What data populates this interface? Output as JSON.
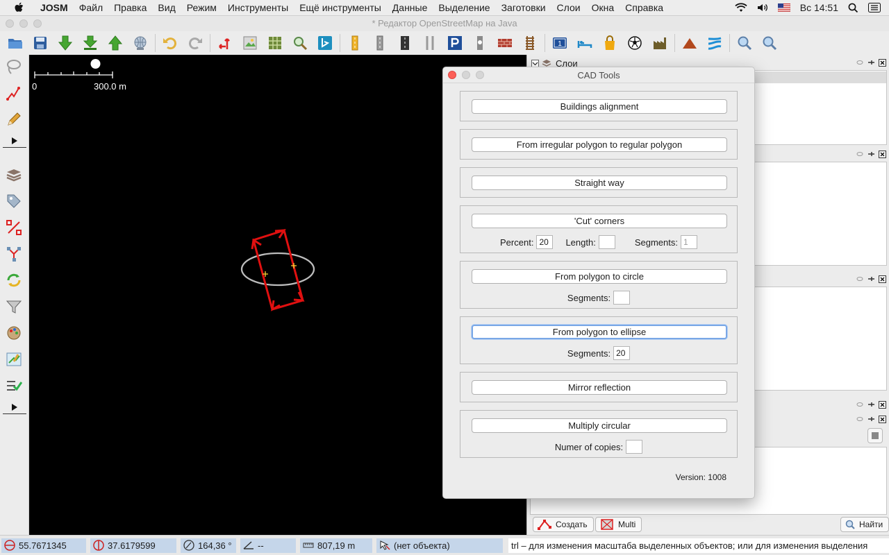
{
  "menubar": {
    "app_name": "JOSM",
    "items": [
      "Файл",
      "Правка",
      "Вид",
      "Режим",
      "Инструменты",
      "Ещё инструменты",
      "Данные",
      "Выделение",
      "Заготовки",
      "Слои",
      "Окна",
      "Справка"
    ],
    "clock": "Вс 14:51"
  },
  "window": {
    "title": "* Редактор OpenStreetMap на Java"
  },
  "map": {
    "scale_start": "0",
    "scale_end": "300.0 m",
    "ellipse": {
      "color": "#bdbdbd"
    },
    "way": {
      "color": "#e01010"
    },
    "node": {
      "color": "#ffd633"
    }
  },
  "right_panel": {
    "layers_title": "Слои",
    "create_button": "Создать",
    "multi_button": "Multi",
    "find_button": "Найти"
  },
  "cad_tools": {
    "title": "CAD Tools",
    "buildings_alignment": "Buildings alignment",
    "irregular_to_regular": "From irregular polygon to regular polygon",
    "straight_way": "Straight way",
    "cut_corners": "'Cut' corners",
    "percent_label": "Percent:",
    "percent_value": "20",
    "length_label": "Length:",
    "length_value": "",
    "segments_label": "Segments:",
    "cut_segments_value": "1",
    "polygon_to_circle": "From polygon to circle",
    "circle_segments_value": "",
    "polygon_to_ellipse": "From polygon to ellipse",
    "ellipse_segments_value": "20",
    "mirror_reflection": "Mirror reflection",
    "multiply_circular": "Multiply circular",
    "copies_label": "Numer of copies:",
    "copies_value": "",
    "version": "Version: 1008"
  },
  "statusbar": {
    "lat": "55.7671345",
    "lon": "37.6179599",
    "heading": "164,36 °",
    "angle": "--",
    "distance": "807,19 m",
    "object": "(нет объекта)",
    "help": "trl – для изменения масштаба выделенных объектов; или для изменения выделения"
  },
  "colors": {
    "accent": "#79a7e6",
    "map_background": "#000000",
    "status_cell": "#c5d6ea"
  }
}
